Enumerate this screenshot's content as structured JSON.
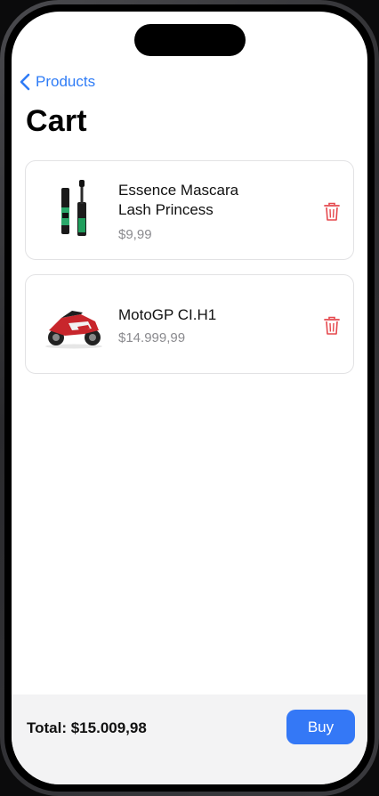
{
  "nav": {
    "back_label": "Products"
  },
  "header": {
    "title": "Cart"
  },
  "cart": {
    "items": [
      {
        "name": "Essence Mascara Lash Princess",
        "price": "$9,99",
        "image_icon": "mascara-product-image"
      },
      {
        "name": "MotoGP CI.H1",
        "price": "$14.999,99",
        "image_icon": "motorcycle-product-image"
      }
    ]
  },
  "footer": {
    "total_label": "Total: $15.009,98",
    "buy_label": "Buy"
  },
  "colors": {
    "accent": "#3478f6",
    "delete": "#e5484d",
    "price_gray": "#8a8a8e"
  }
}
